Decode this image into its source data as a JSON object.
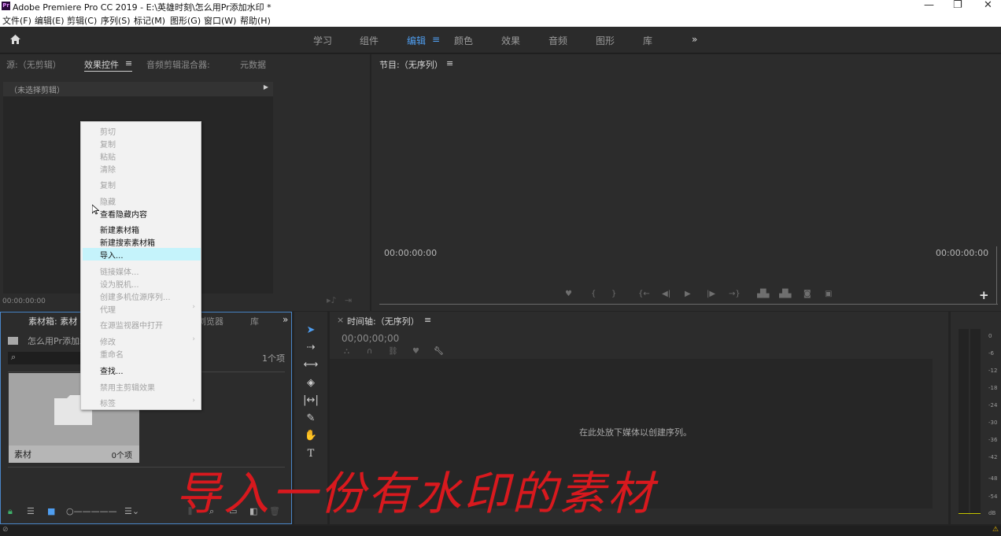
{
  "window": {
    "app_icon": "Pr",
    "title": "Adobe Premiere Pro CC 2019 - E:\\英雄时刻\\怎么用Pr添加水印 *",
    "minimize": "—",
    "restore": "❐",
    "close": "✕"
  },
  "menu": [
    "文件(F)",
    "编辑(E)",
    "剪辑(C)",
    "序列(S)",
    "标记(M)",
    "图形(G)",
    "窗口(W)",
    "帮助(H)"
  ],
  "workspaces": {
    "items": [
      "学习",
      "组件",
      "编辑",
      "颜色",
      "效果",
      "音频",
      "图形",
      "库"
    ],
    "active": "编辑",
    "more": "»"
  },
  "source_panel": {
    "tabs": [
      "源:（无剪辑）",
      "效果控件",
      "音频剪辑混合器:",
      "元数据"
    ],
    "active_tab": "效果控件",
    "menu_icon": "≡",
    "no_clip": "（未选择剪辑）",
    "timecode": "00:00:00:00"
  },
  "program_panel": {
    "title": "节目:（无序列）",
    "menu_icon": "≡",
    "timecode_left": "00:00:00:00",
    "timecode_right": "00:00:00:00",
    "add_button": "+"
  },
  "project_panel": {
    "tab": "素材箱: 素材",
    "tab_browser": "浏览器",
    "tab_library": "库",
    "more": "»",
    "path": "怎么用Pr添加水",
    "item_count": "1个项",
    "bin": {
      "name": "素材",
      "count": "0个项"
    }
  },
  "timeline_panel": {
    "close": "×",
    "title": "时间轴:（无序列）",
    "menu_icon": "≡",
    "timecode": "00;00;00;00",
    "drop_hint": "在此处放下媒体以创建序列。"
  },
  "context_menu": {
    "items": [
      {
        "label": "剪切",
        "enabled": false
      },
      {
        "label": "复制",
        "enabled": false
      },
      {
        "label": "粘贴",
        "enabled": false
      },
      {
        "label": "清除",
        "enabled": false
      },
      {
        "label": "复制",
        "enabled": false
      },
      {
        "label": "隐藏",
        "enabled": false
      },
      {
        "label": "查看隐藏内容",
        "enabled": true
      },
      {
        "label": "新建素材箱",
        "enabled": true
      },
      {
        "label": "新建搜索素材箱",
        "enabled": true
      },
      {
        "label": "导入...",
        "enabled": true,
        "highlighted": true
      },
      {
        "label": "链接媒体...",
        "enabled": false
      },
      {
        "label": "设为脱机...",
        "enabled": false
      },
      {
        "label": "创建多机位源序列...",
        "enabled": false
      },
      {
        "label": "代理",
        "enabled": false,
        "submenu": true
      },
      {
        "label": "在源监视器中打开",
        "enabled": false
      },
      {
        "label": "修改",
        "enabled": false,
        "submenu": true
      },
      {
        "label": "重命名",
        "enabled": false
      },
      {
        "label": "查找...",
        "enabled": true
      },
      {
        "label": "禁用主剪辑效果",
        "enabled": false
      },
      {
        "label": "标签",
        "enabled": false,
        "submenu": true
      }
    ]
  },
  "audio_meter": {
    "labels": [
      "0",
      "-6",
      "-12",
      "-18",
      "-24",
      "-30",
      "-36",
      "-42",
      "-48",
      "-54",
      "dB"
    ]
  },
  "overlay_caption": "导入一份有水印的素材",
  "colors": {
    "accent": "#4f9ef0",
    "highlight": "#c5f3fb",
    "caption": "#d8191e",
    "panel": "#2c2c2c"
  }
}
